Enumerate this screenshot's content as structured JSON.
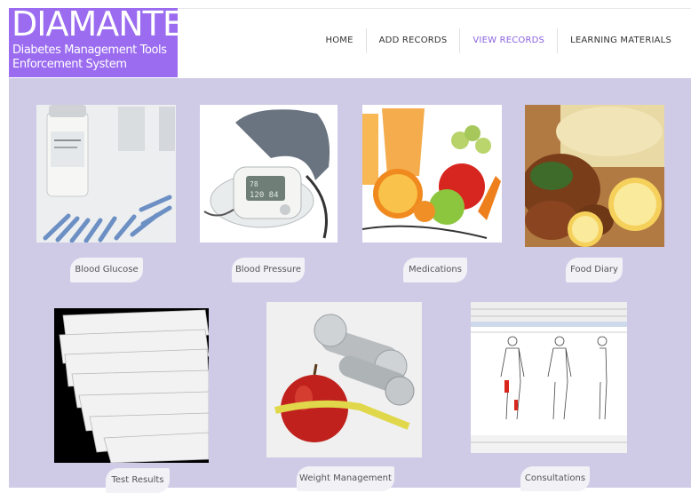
{
  "logo": {
    "title": "DIAMANTES",
    "subtitle_line1": "Diabetes Management Tools",
    "subtitle_line2": "Enforcement System"
  },
  "nav": {
    "items": [
      {
        "label": "HOME"
      },
      {
        "label": "ADD RECORDS"
      },
      {
        "label": "VIEW RECORDS"
      },
      {
        "label": "LEARNING MATERIALS"
      }
    ],
    "active_color": "#8b63e0"
  },
  "tiles": [
    {
      "label": "Blood Glucose"
    },
    {
      "label": "Blood Pressure"
    },
    {
      "label": "Medications"
    },
    {
      "label": "Food Diary"
    },
    {
      "label": "Test Results"
    },
    {
      "label": "Weight Management"
    },
    {
      "label": "Consultations"
    }
  ],
  "colors": {
    "brand": "#9b6cf0",
    "background": "#cfcbe6"
  }
}
